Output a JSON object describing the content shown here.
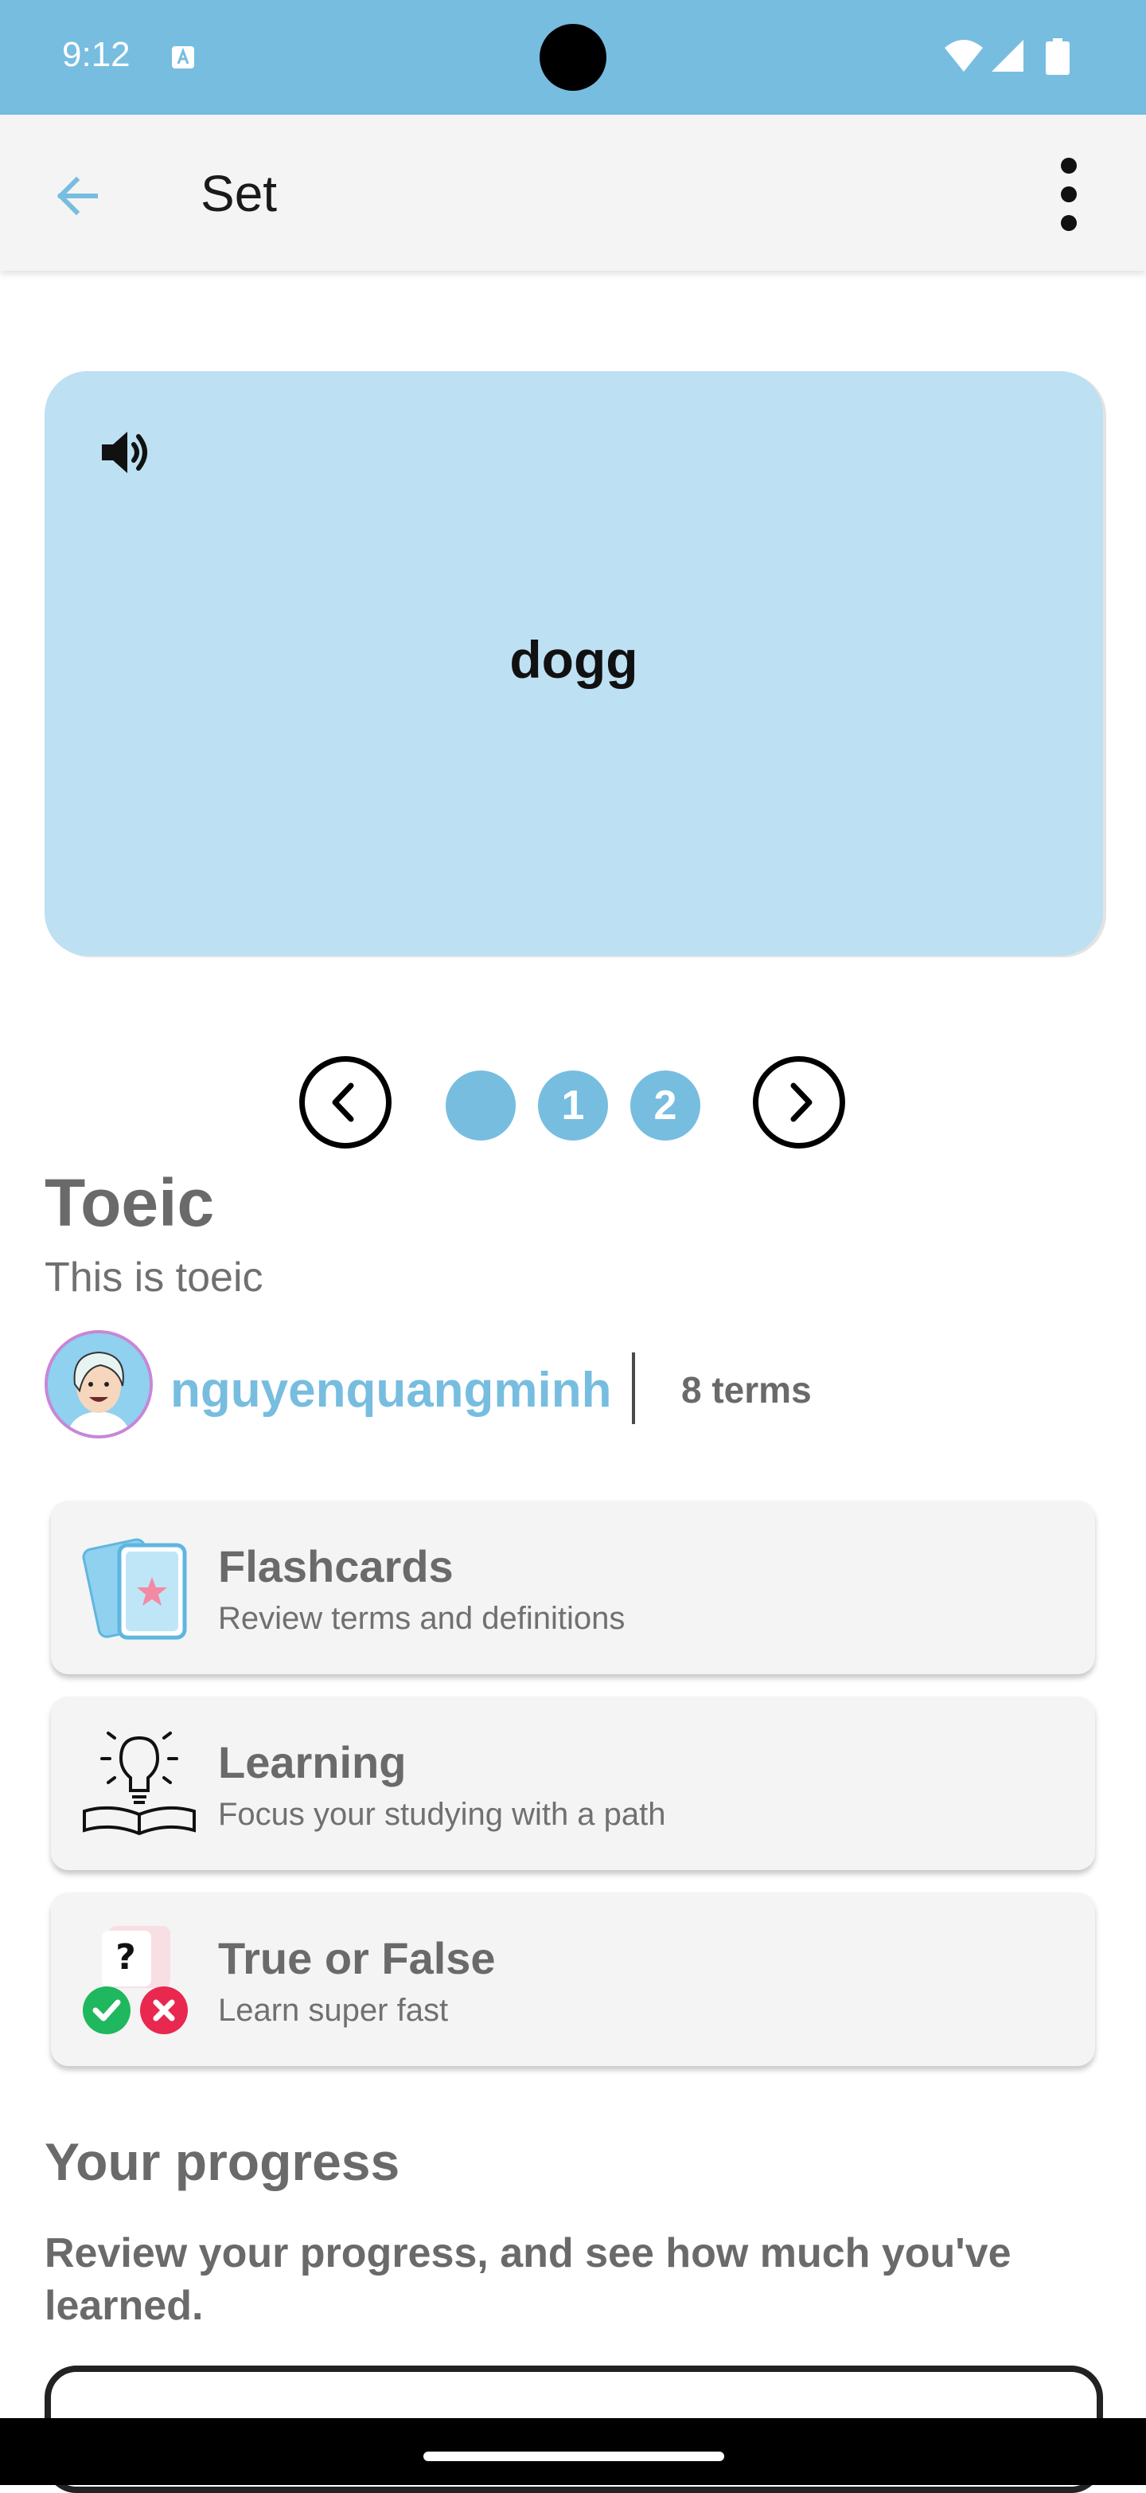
{
  "status_bar": {
    "time": "9:12",
    "background": "#77bde0"
  },
  "app_bar": {
    "title": "Set",
    "back_icon": "arrow-back-icon",
    "menu_icon": "more-vert-icon"
  },
  "flashcard": {
    "term": "dogg",
    "audio_icon": "speaker-icon",
    "background": "#bde0f3"
  },
  "pager": {
    "dots": [
      "",
      "1",
      "2"
    ],
    "prev_icon": "chevron-left-icon",
    "next_icon": "chevron-right-icon"
  },
  "set": {
    "title": "Toeic",
    "description": "This is toeic",
    "author": "nguyenquangminh",
    "term_count": "8 terms"
  },
  "study_modes": [
    {
      "title": "Flashcards",
      "subtitle": "Review terms and definitions",
      "icon": "flashcards-icon"
    },
    {
      "title": "Learning",
      "subtitle": "Focus your studying with a path",
      "icon": "lightbulb-book-icon"
    },
    {
      "title": "True or False",
      "subtitle": "Learn super fast",
      "icon": "true-false-icon"
    }
  ],
  "progress": {
    "title": "Your progress",
    "description": "Review your progress, and see how much you've learned."
  },
  "colors": {
    "accent": "#77bde0",
    "muted_text": "#6a6a6a",
    "avatar_border": "#c787d6"
  }
}
